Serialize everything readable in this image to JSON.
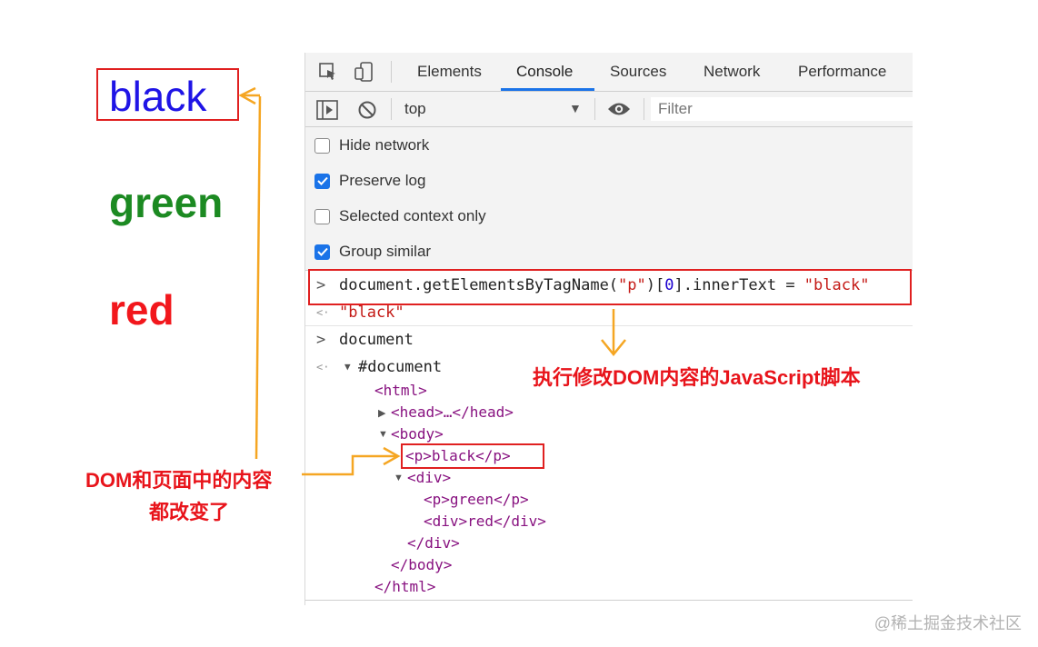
{
  "page": {
    "words": [
      "black",
      "green",
      "red"
    ],
    "colors": {
      "black": "#1f14e6",
      "green": "#1c8a22",
      "red": "#f2171c"
    }
  },
  "devtools": {
    "tabs": [
      "Elements",
      "Console",
      "Sources",
      "Network",
      "Performance"
    ],
    "active_tab": "Console",
    "toolbar": {
      "context": "top",
      "filter_placeholder": "Filter"
    },
    "settings": [
      {
        "label": "Hide network",
        "checked": false
      },
      {
        "label": "Preserve log",
        "checked": true
      },
      {
        "label": "Selected context only",
        "checked": false
      },
      {
        "label": "Group similar",
        "checked": true
      }
    ],
    "console": {
      "cmd1_a": "document.getElementsByTagName(",
      "cmd1_str": "\"p\"",
      "cmd1_b": ")[",
      "cmd1_num": "0",
      "cmd1_c": "].innerText = ",
      "cmd1_val": "\"black\"",
      "result1": "\"black\"",
      "cmd2": "document",
      "doc_root": "#document"
    },
    "dom": {
      "html_open": "<html>",
      "head": "<head>…</head>",
      "body_open": "<body>",
      "p_black": "<p>black</p>",
      "div_open": "<div>",
      "p_green": "<p>green</p>",
      "div_red": "<div>red</div>",
      "div_close": "</div>",
      "body_close": "</body>",
      "html_close": "</html>"
    }
  },
  "annotations": {
    "script_note": "执行修改DOM内容的JavaScript脚本",
    "dom_note_line1": "DOM和页面中的内容",
    "dom_note_line2": "都改变了",
    "accent_red": "#e8141b",
    "arrow_orange": "#f5a623"
  },
  "watermark": "@稀土掘金技术社区"
}
